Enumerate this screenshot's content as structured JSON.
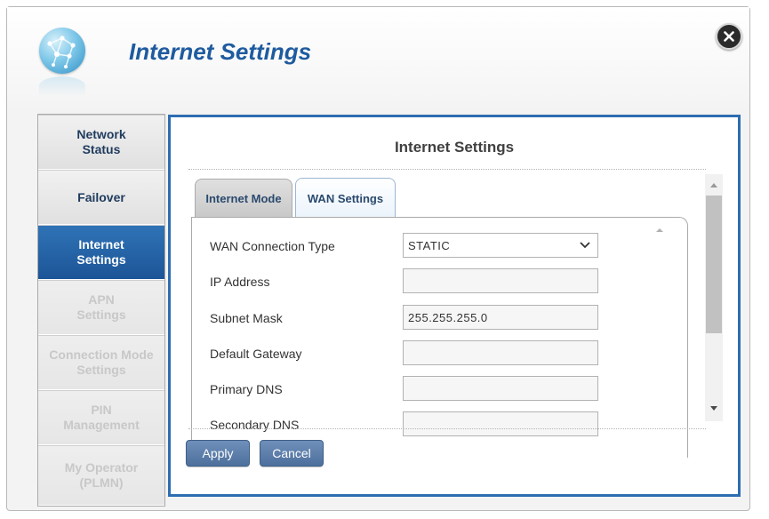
{
  "header": {
    "title": "Internet Settings",
    "icon": "globe-icon",
    "close_icon": "close-icon"
  },
  "sidebar": {
    "items": [
      {
        "label": "Network\nStatus",
        "state": "normal"
      },
      {
        "label": "Failover",
        "state": "normal"
      },
      {
        "label": "Internet\nSettings",
        "state": "active"
      },
      {
        "label": "APN\nSettings",
        "state": "disabled"
      },
      {
        "label": "Connection Mode\nSettings",
        "state": "disabled"
      },
      {
        "label": "PIN\nManagement",
        "state": "disabled"
      },
      {
        "label": "My Operator\n(PLMN)",
        "state": "disabled"
      }
    ]
  },
  "main": {
    "title": "Internet Settings",
    "tabs": [
      {
        "label": "Internet Mode",
        "selected": false
      },
      {
        "label": "WAN Settings",
        "selected": true
      }
    ],
    "form": {
      "wan_connection_type": {
        "label": "WAN Connection Type",
        "value": "STATIC"
      },
      "ip_address": {
        "label": "IP Address",
        "value": ""
      },
      "subnet_mask": {
        "label": "Subnet Mask",
        "value": "255.255.255.0"
      },
      "default_gateway": {
        "label": "Default Gateway",
        "value": ""
      },
      "primary_dns": {
        "label": "Primary DNS",
        "value": ""
      },
      "secondary_dns": {
        "label": "Secondary DNS",
        "value": ""
      }
    },
    "buttons": {
      "apply": "Apply",
      "cancel": "Cancel"
    }
  },
  "colors": {
    "accent": "#2d6db1",
    "title_blue": "#1e5b9f",
    "active_nav": "#1c5597",
    "button": "#5a7ca8"
  }
}
